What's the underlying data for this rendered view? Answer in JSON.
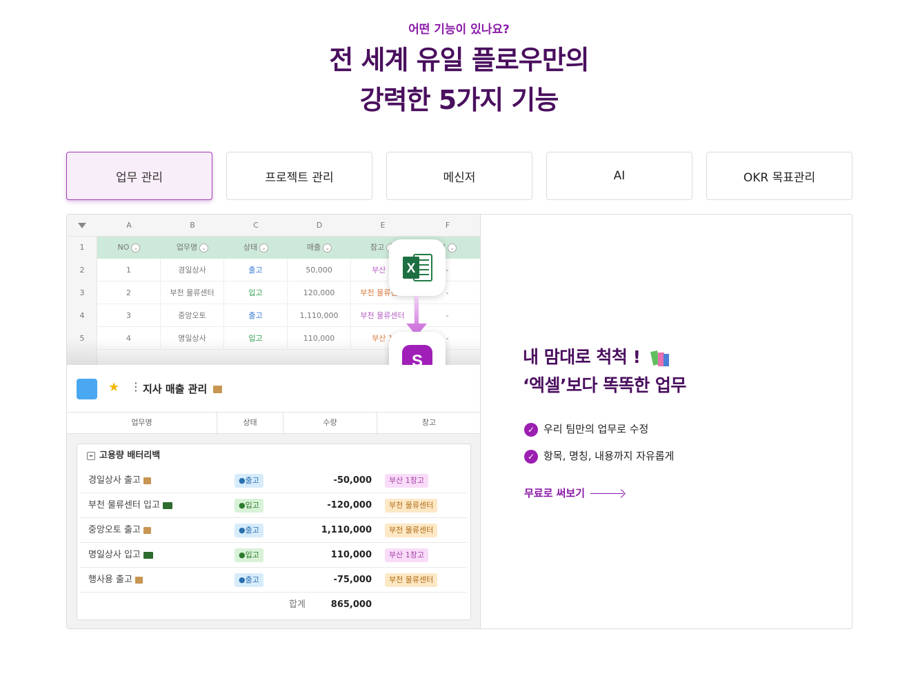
{
  "header": {
    "eyebrow": "어떤 기능이 있나요?",
    "title_line1": "전 세계 유일 플로우만의",
    "title_line2": "강력한 5가지 기능"
  },
  "tabs": [
    {
      "label": "업무 관리",
      "active": true
    },
    {
      "label": "프로젝트 관리",
      "active": false
    },
    {
      "label": "메신저",
      "active": false
    },
    {
      "label": "AI",
      "active": false
    },
    {
      "label": "OKR 목표관리",
      "active": false
    }
  ],
  "sheet": {
    "columns": [
      "A",
      "B",
      "C",
      "D",
      "E",
      "F"
    ],
    "row_numbers": [
      "1",
      "2",
      "3",
      "4",
      "5"
    ],
    "headers": [
      "NO",
      "업무명",
      "상태",
      "매출",
      "참고",
      "고"
    ],
    "rows": [
      [
        "1",
        "경일상사",
        "출고",
        "50,000",
        "부산 1",
        "-"
      ],
      [
        "2",
        "부천 물류센터",
        "입고",
        "120,000",
        "부천 물류센터",
        "-"
      ],
      [
        "3",
        "중앙오토",
        "출고",
        "1,110,000",
        "부천 물류센터",
        "-"
      ],
      [
        "4",
        "명일상사",
        "입고",
        "110,000",
        "부산 1",
        "-"
      ]
    ]
  },
  "icons": {
    "excel": "excel-icon",
    "flow": "flow-icon",
    "excel_letter": "X",
    "flow_letter": "S"
  },
  "task": {
    "title": "지사 매출 관리",
    "columns": [
      "업무명",
      "상태",
      "수량",
      "창고"
    ],
    "group_name": "고용량 배터리백",
    "rows": [
      {
        "name": "경일상사 출고",
        "status": "●출고",
        "amount": "-50,000",
        "location": "부산 1창고"
      },
      {
        "name": "부천 물류센터 입고",
        "status": "●입고",
        "amount": "-120,000",
        "location": "부천 물류센터"
      },
      {
        "name": "중앙오토 출고",
        "status": "●출고",
        "amount": "1,110,000",
        "location": "부천 물류센터"
      },
      {
        "name": "명일상사 입고",
        "status": "●입고",
        "amount": "110,000",
        "location": "부산 1창고"
      },
      {
        "name": "행사용 출고",
        "status": "●출고",
        "amount": "-75,000",
        "location": "부천 물류센터"
      }
    ],
    "total_label": "합계",
    "total_value": "865,000"
  },
  "feature": {
    "title_line1": "내 맘대로 척척 !",
    "title_line2": "‘엑셀’보다 똑똑한 업무",
    "bullets": [
      "우리 팀만의 업무로 수정",
      "항목, 명칭, 내용까지 자유롭게"
    ],
    "cta": "무료로 써보기"
  },
  "colors": {
    "accent": "#8a1aa8",
    "headline": "#4a0f5e",
    "sheet_header": "#cde9d9"
  }
}
